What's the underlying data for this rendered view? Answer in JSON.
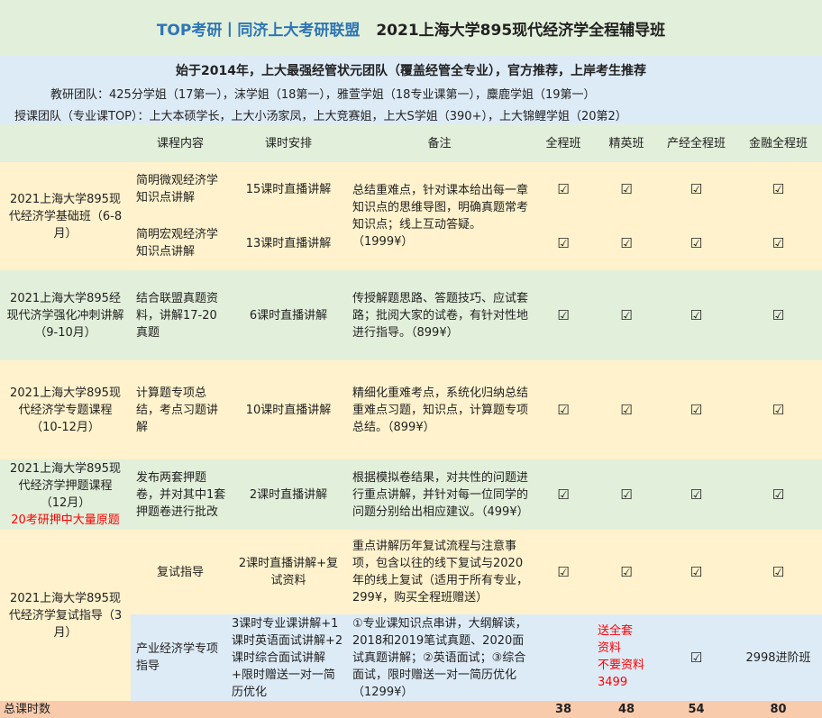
{
  "header": {
    "brand": "TOP考研丨同济上大考研联盟",
    "title": "2021上海大学895现代经济学全程辅导班"
  },
  "intro": {
    "tagline": "始于2014年，上大最强经管状元团队（覆盖经管全专业），官方推荐，上岸考生推荐",
    "research_team": "教研团队：425分学姐（17第一），沫学姐（18第一），雅萱学姐（18专业课第一），麋鹿学姐（19第一）",
    "teaching_team": "授课团队（专业课TOP）：上大本硕学长，上大小汤家凤，上大竞赛姐，上大S学姐（390+），上大锦鲤学姐（20第2）"
  },
  "columns": {
    "content": "课程内容",
    "hours": "课时安排",
    "notes": "备注",
    "full": "全程班",
    "elite": "精英班",
    "industrial": "产经全程班",
    "finance": "金融全程班"
  },
  "check_symbol": "☑",
  "stages": {
    "basic": "2021上海大学895现代经济学基础班（6-8月）",
    "intensive": "2021上海大学895经现代济学强化冲刺讲解（9-10月）",
    "topic": "2021上海大学895现代经济学专题课程（10-12月）",
    "predict": "2021上海大学895现代经济学押题课程（12月）",
    "predict_note": "20考研押中大量原题",
    "retest": "2021上海大学895现代经济学复试指导（3月）"
  },
  "rows": {
    "micro": {
      "content": "简明微观经济学知识点讲解",
      "hours": "15课时直播讲解"
    },
    "macro": {
      "content": "简明宏观经济学知识点讲解",
      "hours": "13课时直播讲解"
    },
    "basic_note": "总结重难点，针对课本给出每一章知识点的思维导图，明确真题常考知识点；线上互动答疑。（1999¥）",
    "intensive": {
      "content": "结合联盟真题资料，讲解17-20真题",
      "hours": "6课时直播讲解",
      "note": "传授解题思路、答题技巧、应试套路；批阅大家的试卷，有针对性地进行指导。（899¥）"
    },
    "topic": {
      "content": "计算题专项总结，考点习题讲解",
      "hours": "10课时直播讲解",
      "note": "精细化重难考点，系统化归纳总结重难点习题，知识点，计算题专项总结。（899¥）"
    },
    "predict": {
      "content": "发布两套押题卷，并对其中1套押题卷进行批改",
      "hours": "2课时直播讲解",
      "note": "根据模拟卷结果，对共性的问题进行重点讲解，并针对每一位同学的问题分别给出相应建议。（499¥）"
    },
    "retest": {
      "content": "复试指导",
      "hours": "2课时直播讲解+复试资料",
      "note": "重点讲解历年复试流程与注意事项，包含以往的线下复试与2020年的线上复试（适用于所有专业，299¥，购买全程班赠送）"
    },
    "industry": {
      "content": "产业经济学专项指导",
      "hours": "3课时专业课讲解+1课时英语面试讲解+2课时综合面试讲解+限时赠送一对一简历优化",
      "note": "①专业课知识点串讲，大纲解读，2018和2019笔试真题、2020面试真题讲解；②英语面试；③综合面试，限时赠送一对一简历优化（1299¥）",
      "elite_note_lines": [
        "送全套",
        "资料",
        "不要资料",
        "3499"
      ],
      "finance_note": "2998进阶班"
    }
  },
  "totals": {
    "label": "总课时数",
    "full": "38",
    "elite": "48",
    "industrial": "54",
    "finance": "80"
  }
}
